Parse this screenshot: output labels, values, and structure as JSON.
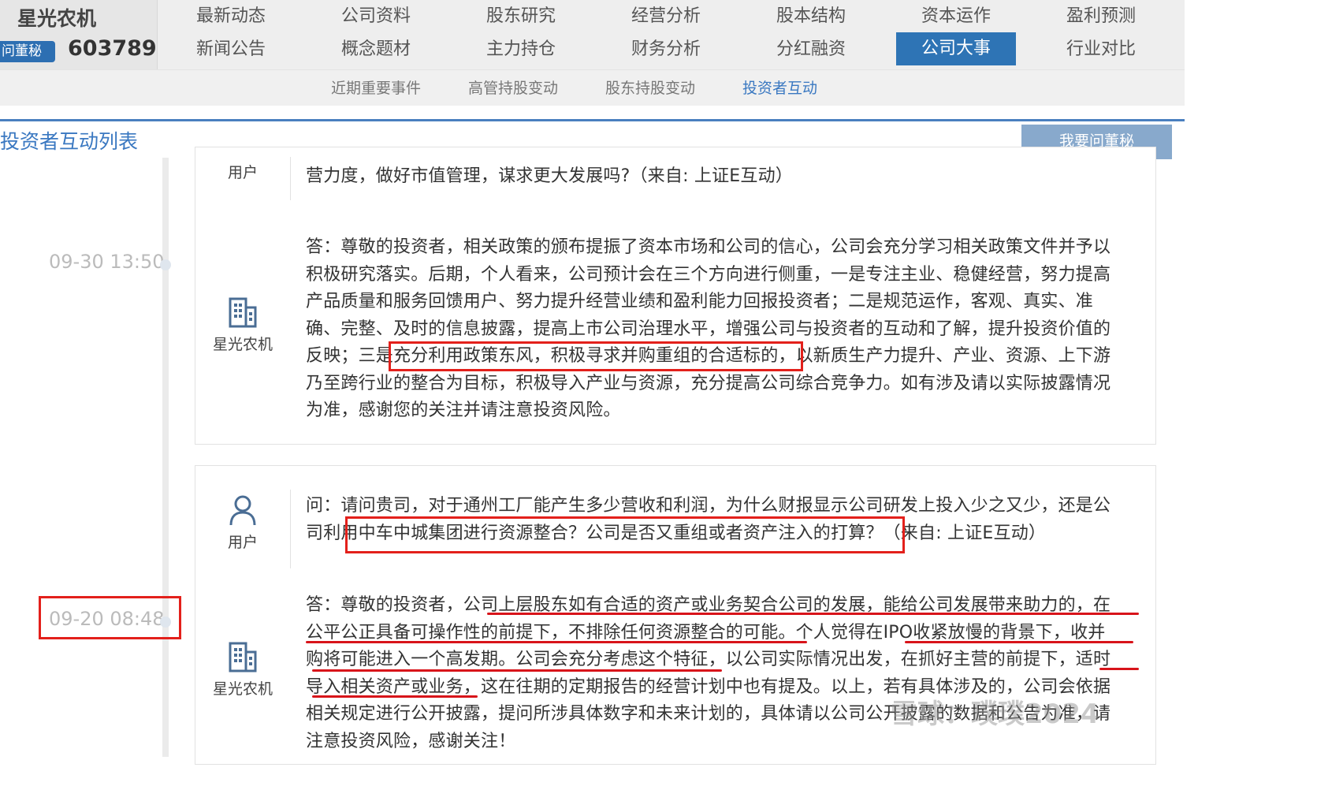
{
  "company": {
    "name": "星光农机",
    "ask_badge": "问董秘",
    "code": "603789"
  },
  "nav": {
    "row1": [
      "最新动态",
      "公司资料",
      "股东研究",
      "经营分析",
      "股本结构",
      "资本运作",
      "盈利预测"
    ],
    "row2": [
      "新闻公告",
      "概念题材",
      "主力持仓",
      "财务分析",
      "分红融资",
      "公司大事",
      "行业对比"
    ],
    "active": "公司大事"
  },
  "subnav": {
    "items": [
      "近期重要事件",
      "高管持股变动",
      "股东持股变动",
      "投资者互动"
    ],
    "active": "投资者互动"
  },
  "section": {
    "title": "投资者互动列表",
    "ask_button": "我要问董秘"
  },
  "timeline": [
    {
      "time": "09-30 13:50"
    },
    {
      "time": "09-20 08:48"
    }
  ],
  "entries": [
    {
      "question": {
        "role": "用户",
        "lines": [
          "营力度，做好市值管理，谋求更大发展吗?（来自: 上证E互动）"
        ]
      },
      "answer": {
        "role": "星光农机",
        "lines": [
          "答：尊敬的投资者，相关政策的颁布提振了资本市场和公司的信心，公司会充分学习相关政策文件并予以",
          "积极研究落实。后期，个人看来，公司预计会在三个方向进行侧重，一是专注主业、稳健经营，努力提高",
          "产品质量和服务回馈用户、努力提升经营业绩和盈利能力回报投资者；二是规范运作，客观、真实、准",
          "确、完整、及时的信息披露，提高上市公司治理水平，增强公司与投资者的互动和了解，提升投资价值的",
          "反映；三是充分利用政策东风，积极寻求并购重组的合适标的，以新质生产力提升、产业、资源、上下游",
          "乃至跨行业的整合为目标，积极导入产业与资源，充分提高公司综合竞争力。如有涉及请以实际披露情况",
          "为准，感谢您的关注并请注意投资风险。"
        ]
      }
    },
    {
      "question": {
        "role": "用户",
        "lines": [
          "问：请问贵司，对于通州工厂能产生多少营收和利润，为什么财报显示公司研发上投入少之又少，还是公",
          "司利用中车中城集团进行资源整合？公司是否又重组或者资产注入的打算？（来自: 上证E互动）"
        ]
      },
      "answer": {
        "role": "星光农机",
        "lines": [
          "答：尊敬的投资者，公司上层股东如有合适的资产或业务契合公司的发展，能给公司发展带来助力的，在",
          "公平公正具备可操作性的前提下，不排除任何资源整合的可能。个人觉得在IPO收紧放慢的背景下，收并",
          "购将可能进入一个高发期。公司会充分考虑这个特征，以公司实际情况出发，在抓好主营的前提下，适时",
          "导入相关资产或业务，这在往期的定期报告的经营计划中也有提及。以上，若有具体涉及的，公司会依据",
          "相关规定进行公开披露，提问所涉具体数字和未来计划的，具体请以公司公开披露的数据和公告为准，请",
          "注意投资风险，感谢关注！"
        ]
      }
    }
  ],
  "watermark": "雪球：璞璞2024"
}
